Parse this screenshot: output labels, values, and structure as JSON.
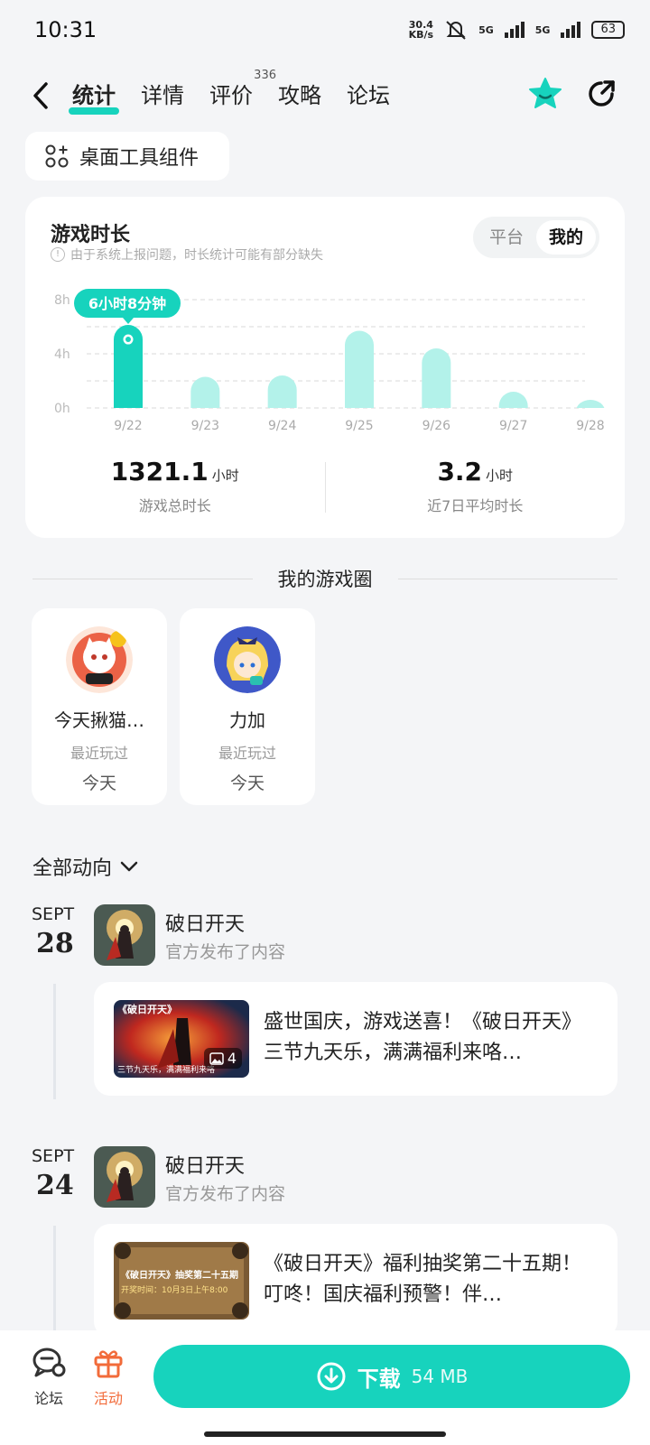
{
  "status_bar": {
    "time": "10:31",
    "speed_value": "30.4",
    "speed_unit": "KB/s",
    "network1": "5G",
    "network2": "5G",
    "battery": "63"
  },
  "nav": {
    "back_icon": "chevron-left-icon",
    "tabs": [
      {
        "label": "统计",
        "active": true
      },
      {
        "label": "详情"
      },
      {
        "label": "评价",
        "count": "336"
      },
      {
        "label": "攻略"
      },
      {
        "label": "论坛"
      }
    ],
    "icons": [
      "star-icon",
      "share-icon"
    ]
  },
  "widget_button": {
    "label": "桌面工具组件",
    "icon": "widgets-icon"
  },
  "playtime_card": {
    "title": "游戏时长",
    "note": "由于系统上报问题，时长统计可能有部分缺失",
    "segment": {
      "options": [
        "平台",
        "我的"
      ],
      "selected": "我的"
    },
    "tooltip": "6小时8分钟",
    "total_value": "1321.1",
    "total_unit": "小时",
    "total_label": "游戏总时长",
    "avg_value": "3.2",
    "avg_unit": "小时",
    "avg_label": "近7日平均时长"
  },
  "chart_data": {
    "type": "bar",
    "categories": [
      "9/22",
      "9/23",
      "9/24",
      "9/25",
      "9/26",
      "9/27",
      "9/28"
    ],
    "values": [
      6.13,
      2.3,
      2.4,
      5.7,
      4.4,
      1.2,
      0.6
    ],
    "y_ticks": [
      "8h",
      "4h",
      "0h"
    ],
    "ylim": [
      0,
      8
    ],
    "highlight_index": 0,
    "colors": {
      "highlight": "#17d3bd",
      "normal": "#b3f2ea"
    }
  },
  "game_circle": {
    "title": "我的游戏圈",
    "games": [
      {
        "name": "今天揪猫…",
        "sub": "最近玩过",
        "time": "今天"
      },
      {
        "name": "力加",
        "sub": "最近玩过",
        "time": "今天"
      }
    ]
  },
  "feed": {
    "filter_label": "全部动向",
    "items": [
      {
        "month": "SEPT",
        "day": "28",
        "game": "破日开天",
        "action": "官方发布了内容",
        "post_text": "盛世国庆，游戏送喜！《破日开天》三节九天乐，满满福利来咯…",
        "image_count": "4",
        "thumb_title": "《破日开天》",
        "thumb_caption": "三节九天乐，满满福利来咯"
      },
      {
        "month": "SEPT",
        "day": "24",
        "game": "破日开天",
        "action": "官方发布了内容",
        "post_text": "《破日开天》福利抽奖第二十五期！ 叮咚！国庆福利预警！伴…",
        "thumb_title": "《破日开天》抽奖第二十五期",
        "thumb_caption": "开奖时间：10月3日上午8:00"
      }
    ]
  },
  "bottom_bar": {
    "forum_label": "论坛",
    "event_label": "活动",
    "download_label": "下载",
    "download_size": "54 MB"
  }
}
